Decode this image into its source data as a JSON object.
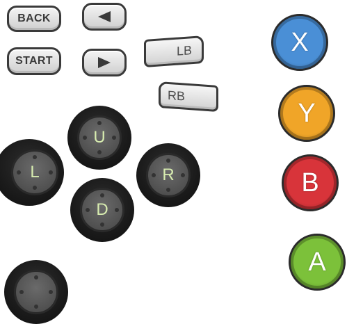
{
  "menu_buttons": {
    "back_label": "BACK",
    "start_label": "START",
    "left_arrow_icon": "left-arrow-icon",
    "right_arrow_icon": "right-arrow-icon"
  },
  "bumpers": {
    "lb_label": "LB",
    "rb_label": "RB"
  },
  "dpad": {
    "up_label": "U",
    "left_label": "L",
    "right_label": "R",
    "down_label": "D"
  },
  "face_buttons": {
    "x": {
      "label": "X",
      "color": "#4a8fd6"
    },
    "y": {
      "label": "Y",
      "color": "#f0a528"
    },
    "b": {
      "label": "B",
      "color": "#d8343a"
    },
    "a": {
      "label": "A",
      "color": "#7cc13a"
    }
  },
  "colors": {
    "outline": "#3a3a3a",
    "stick_body": "#1a1a1a",
    "stick_face": "#565656",
    "stick_label": "#d8edb0"
  }
}
